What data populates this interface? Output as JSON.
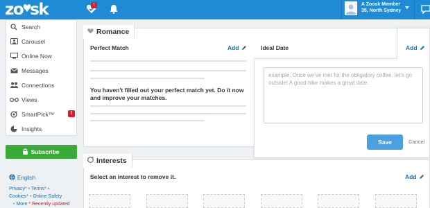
{
  "header": {
    "logo_text": "zoosk",
    "notification_badge": "!",
    "member_name": "A Zoosk Member",
    "member_location": "35, North Sydney",
    "brand_color": "#1f8ad6"
  },
  "sidebar": {
    "items": [
      {
        "label": "Search",
        "icon": "search-icon"
      },
      {
        "label": "Carousel",
        "icon": "carousel-icon"
      },
      {
        "label": "Online Now",
        "icon": "online-now-icon"
      },
      {
        "label": "Messages",
        "icon": "envelope-icon"
      },
      {
        "label": "Connections",
        "icon": "connections-icon"
      },
      {
        "label": "Views",
        "icon": "glasses-icon"
      },
      {
        "label": "SmartPick™",
        "icon": "smartpick-icon",
        "badge": "!"
      },
      {
        "label": "Insights",
        "icon": "insights-icon"
      }
    ],
    "subscribe_label": "Subscribe",
    "language": "English",
    "footer": {
      "privacy": "Privacy*",
      "terms": "Terms*",
      "cookies": "Cookies*",
      "online_safety": "Online Safety",
      "more": "More",
      "recently_updated": "* Recently updated"
    }
  },
  "romance": {
    "title": "Romance",
    "perfect_match_label": "Perfect Match",
    "add_label": "Add",
    "ideal_date_label": "Ideal Date",
    "ideal_add_label": "Add",
    "perfect_match_message": "You haven't filled out your perfect match yet. Do it now and improve your matches.",
    "ideal_date_placeholder": "example: Once we've met for the obligatory coffee, let's go outside! A good hike makes a great date.",
    "save_label": "Save",
    "cancel_label": "Cancel"
  },
  "interests": {
    "title": "Interests",
    "prompt": "Select an interest to remove it.",
    "add_label": "Add"
  }
}
